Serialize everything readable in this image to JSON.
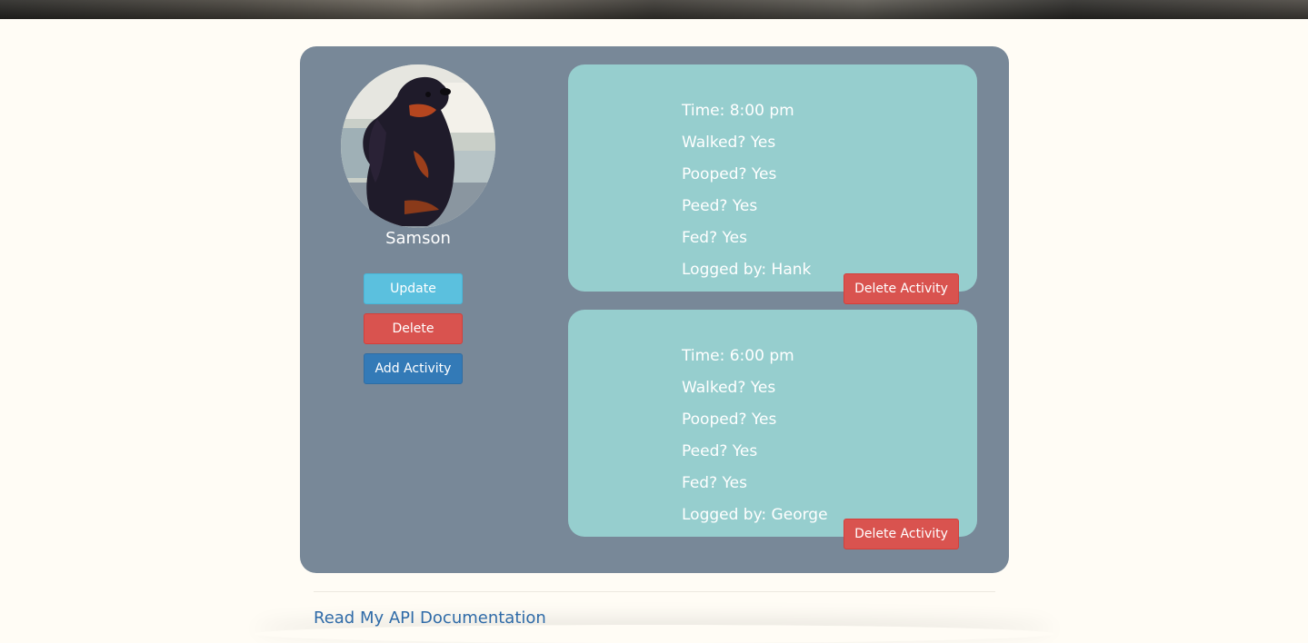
{
  "dog": {
    "name": "Samson"
  },
  "profile_actions": {
    "update_label": "Update",
    "delete_label": "Delete",
    "add_activity_label": "Add Activity"
  },
  "activities": [
    {
      "time": "Time: 8:00 pm",
      "walked": "Walked? Yes",
      "pooped": "Pooped? Yes",
      "peed": "Peed? Yes",
      "fed": "Fed? Yes",
      "logged_by": "Logged by: Hank",
      "delete_label": "Delete Activity"
    },
    {
      "time": "Time: 6:00 pm",
      "walked": "Walked? Yes",
      "pooped": "Pooped? Yes",
      "peed": "Peed? Yes",
      "fed": "Fed? Yes",
      "logged_by": "Logged by: George",
      "delete_label": "Delete Activity"
    }
  ],
  "footer": {
    "api_link_label": "Read My API Documentation"
  },
  "colors": {
    "page_background": "#fffcf5",
    "card_background": "#788898",
    "activity_background": "#96cece",
    "update_button": "#5bc0de",
    "delete_button": "#d9534f",
    "add_activity_button": "#337ab7",
    "link": "#2f6ba8"
  }
}
